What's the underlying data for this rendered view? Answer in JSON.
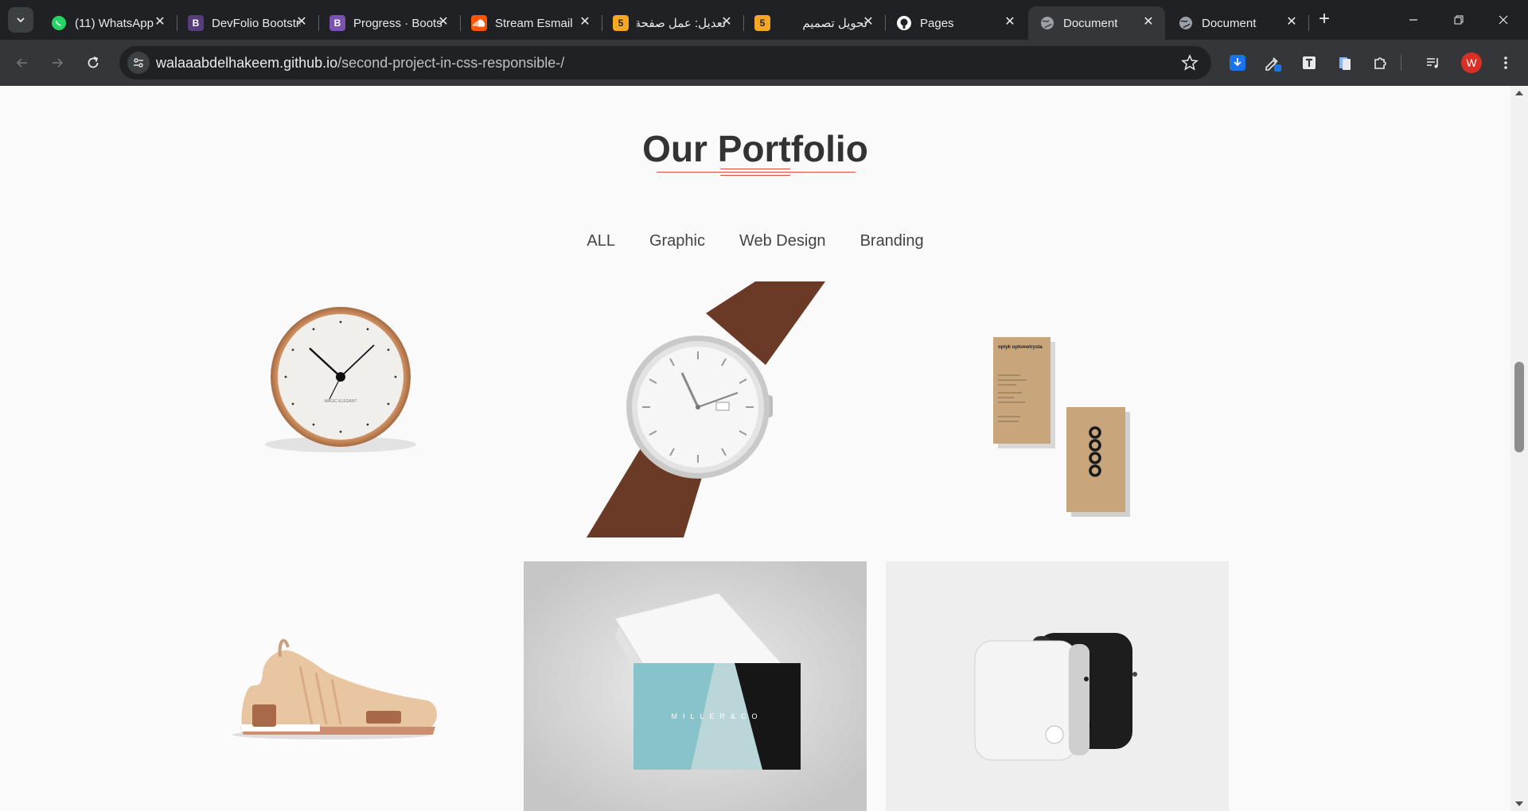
{
  "browser": {
    "tabs": [
      {
        "title": "(11) WhatsApp",
        "favicon": "whatsapp-icon",
        "color": "#25d366"
      },
      {
        "title": "DevFolio Bootstrap",
        "favicon": "bootstrap-icon",
        "color": "#563d7c"
      },
      {
        "title": "Progress · Bootstrap",
        "favicon": "bootstrap-icon",
        "color": "#7952b3"
      },
      {
        "title": "Stream Esmail",
        "favicon": "soundcloud-icon",
        "color": "#ff5500"
      },
      {
        "title": "تعديل: عمل صفحة",
        "favicon": "khamsat-icon",
        "color": "#f5a623"
      },
      {
        "title": "تحويل تصميم",
        "favicon": "khamsat-icon",
        "color": "#f5a623"
      },
      {
        "title": "Pages",
        "favicon": "github-icon",
        "color": "#ffffff"
      },
      {
        "title": "Document",
        "favicon": "globe-icon",
        "color": "#9aa0a6",
        "active": true
      },
      {
        "title": "Document",
        "favicon": "globe-icon",
        "color": "#9aa0a6"
      }
    ],
    "url_host": "walaaabdelhakeem.github.io",
    "url_path": "/second-project-in-css-responsible-/",
    "profile_initial": "W"
  },
  "portfolio": {
    "title": "Our Portfolio",
    "filters": [
      "ALL",
      "Graphic",
      "Web Design",
      "Branding"
    ],
    "items": [
      {
        "name": "copper-wall-clock",
        "label": "MAGIC ELEGANT"
      },
      {
        "name": "silver-wristwatch-brown-strap"
      },
      {
        "name": "kraft-business-cards",
        "label": "optyk optometrysta"
      },
      {
        "name": "leather-sneaker"
      },
      {
        "name": "miller-and-co-business-cards",
        "label": "MILLER&CO"
      },
      {
        "name": "white-black-devices"
      }
    ],
    "accent_color": "#e64a3b"
  }
}
